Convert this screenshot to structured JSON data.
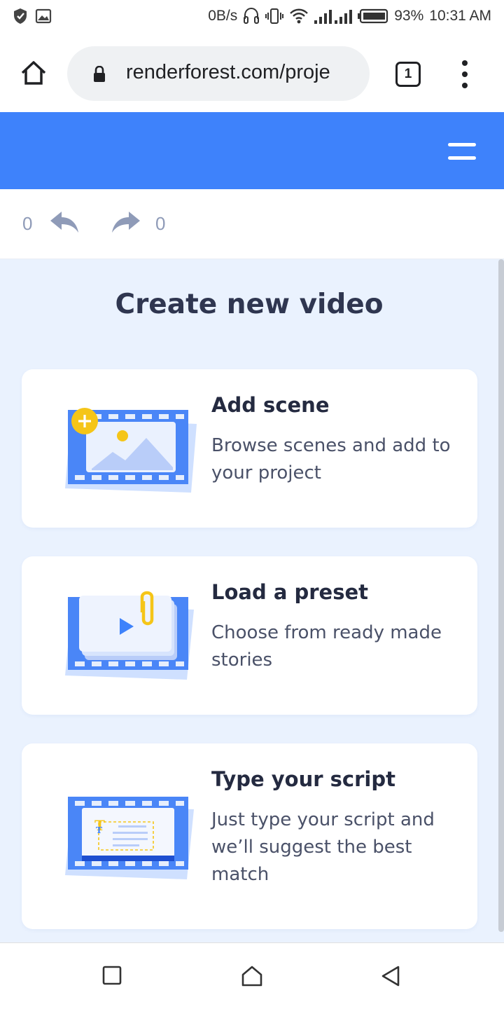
{
  "status": {
    "speed": "0B/s",
    "battery": "93%",
    "time": "10:31 AM"
  },
  "browser": {
    "url": "renderforest.com/proje",
    "tab_count": "1"
  },
  "history": {
    "undo_count": "0",
    "redo_count": "0"
  },
  "main": {
    "title": "Create new video",
    "cards": [
      {
        "title": "Add scene",
        "description": "Browse scenes and add to your project"
      },
      {
        "title": "Load a preset",
        "description": "Choose from ready made stories"
      },
      {
        "title": "Type your script",
        "description": "Just type your script and we’ll suggest the best match"
      }
    ]
  },
  "colors": {
    "header_blue": "#3e82fb",
    "panel_bg": "#eaf2fe",
    "accent_yellow": "#f5c518"
  },
  "icons": {
    "status_left": [
      "shield-icon",
      "image-icon"
    ],
    "status_right": [
      "headset-icon",
      "vibrate-icon",
      "wifi-icon",
      "signal-icon",
      "battery-icon"
    ],
    "browser": [
      "home-icon",
      "lock-icon",
      "tabs-icon",
      "more-vert-icon"
    ],
    "header": [
      "hamburger-menu-icon"
    ],
    "history": [
      "undo-icon",
      "redo-icon"
    ],
    "nav": [
      "recents-icon",
      "home-icon",
      "back-icon"
    ]
  }
}
